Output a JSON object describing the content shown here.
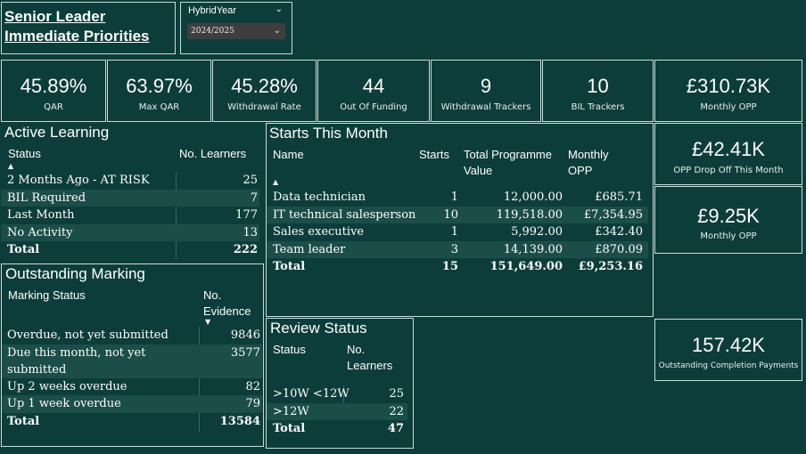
{
  "header": {
    "title_line1": "Senior Leader",
    "title_line2": "Immediate Priorities",
    "slicer": {
      "label": "HybridYear",
      "value": "2024/2025"
    }
  },
  "kpis": [
    {
      "value": "45.89%",
      "label": "QAR"
    },
    {
      "value": "63.97%",
      "label": "Max QAR"
    },
    {
      "value": "45.28%",
      "label": "Withdrawal Rate"
    },
    {
      "value": "44",
      "label": "Out Of Funding"
    },
    {
      "value": "9",
      "label": "Withdrawal Trackers"
    },
    {
      "value": "10",
      "label": "BIL Trackers"
    },
    {
      "value": "£310.73K",
      "label": "Monthly OPP"
    }
  ],
  "side_kpis": [
    {
      "value": "£42.41K",
      "label": "OPP Drop Off This Month"
    },
    {
      "value": "£9.25K",
      "label": "Monthly OPP"
    },
    {
      "value": "157.42K",
      "label": "Outstanding Completion Payments"
    }
  ],
  "active_learning": {
    "title": "Active Learning",
    "col_status": "Status",
    "col_learners": "No. Learners",
    "rows": [
      {
        "status": "2 Months Ago - AT RISK",
        "learners": "25"
      },
      {
        "status": "BIL Required",
        "learners": "7"
      },
      {
        "status": "Last Month",
        "learners": "177"
      },
      {
        "status": "No Activity",
        "learners": "13"
      }
    ],
    "total_label": "Total",
    "total_value": "222"
  },
  "outstanding_marking": {
    "title": "Outstanding Marking",
    "col_status": "Marking Status",
    "col_evidence_1": "No.",
    "col_evidence_2": "Evidence",
    "rows": [
      {
        "status": "Overdue, not yet submitted",
        "evidence": "9846"
      },
      {
        "status": "Due this month, not yet",
        "status2": "submitted",
        "evidence": "3577"
      },
      {
        "status": "Up 2 weeks overdue",
        "evidence": "82"
      },
      {
        "status": "Up 1 week overdue",
        "evidence": "79"
      }
    ],
    "total_label": "Total",
    "total_value": "13584"
  },
  "starts": {
    "title": "Starts This Month",
    "col_name": "Name",
    "col_starts": "Starts",
    "col_tpv_1": "Total Programme",
    "col_tpv_2": "Value",
    "col_opp_1": "Monthly",
    "col_opp_2": "OPP",
    "rows": [
      {
        "name": "Data technician",
        "starts": "1",
        "tpv": "12,000.00",
        "opp": "£685.71"
      },
      {
        "name": "IT technical salesperson",
        "starts": "10",
        "tpv": "119,518.00",
        "opp": "£7,354.95"
      },
      {
        "name": "Sales executive",
        "starts": "1",
        "tpv": "5,992.00",
        "opp": "£342.40"
      },
      {
        "name": "Team leader",
        "starts": "3",
        "tpv": "14,139.00",
        "opp": "£870.09"
      }
    ],
    "total_label": "Total",
    "total_starts": "15",
    "total_tpv": "151,649.00",
    "total_opp": "£9,253.16"
  },
  "review": {
    "title": "Review Status",
    "col_status": "Status",
    "col_learners_1": "No.",
    "col_learners_2": "Learners",
    "rows": [
      {
        "status": ">10W <12W",
        "learners": "25"
      },
      {
        "status": ">12W",
        "learners": "22"
      }
    ],
    "total_label": "Total",
    "total_value": "47"
  }
}
